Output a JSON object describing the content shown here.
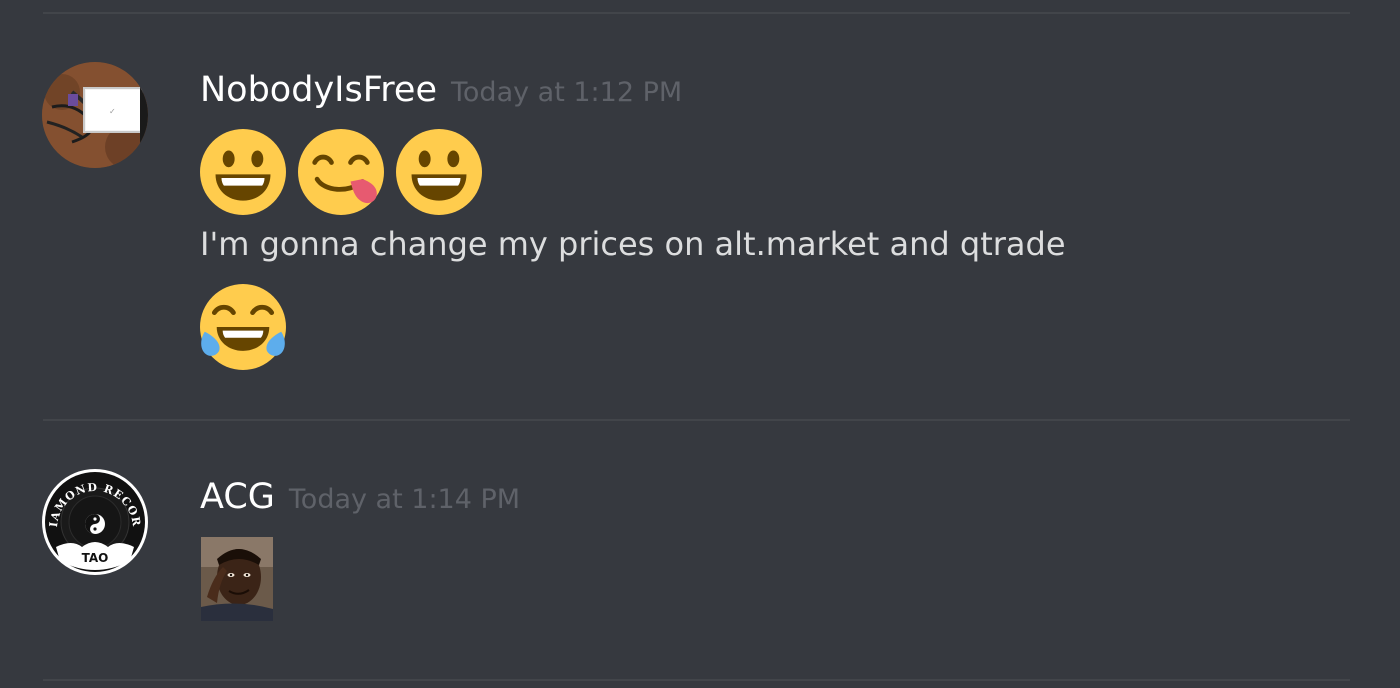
{
  "messages": [
    {
      "username": "NobodyIsFree",
      "timestamp": "Today at 1:12 PM",
      "avatar_icon": "device-photo-avatar",
      "emojis": [
        "smiley-emoji",
        "yum-emoji",
        "smiley-emoji"
      ],
      "text": "I'm gonna change my prices on alt.market and qtrade",
      "reaction_emoji": "joy-emoji"
    },
    {
      "username": "ACG",
      "timestamp": "Today at 1:14 PM",
      "avatar_icon": "diamond-record-avatar",
      "avatar_logo_text": "DIAMOND RECORD",
      "avatar_logo_subtext": "TAO",
      "attachment_icon": "thinking-man-meme-image"
    }
  ],
  "colors": {
    "background": "#36393f",
    "divider": "#42454a",
    "username": "#ffffff",
    "timestamp": "#5f6269",
    "text": "#dcddde",
    "emoji_yellow": "#ffcc4d",
    "emoji_dark": "#664500",
    "tear_blue": "#5dadec",
    "tongue_pink": "#e75a70"
  }
}
